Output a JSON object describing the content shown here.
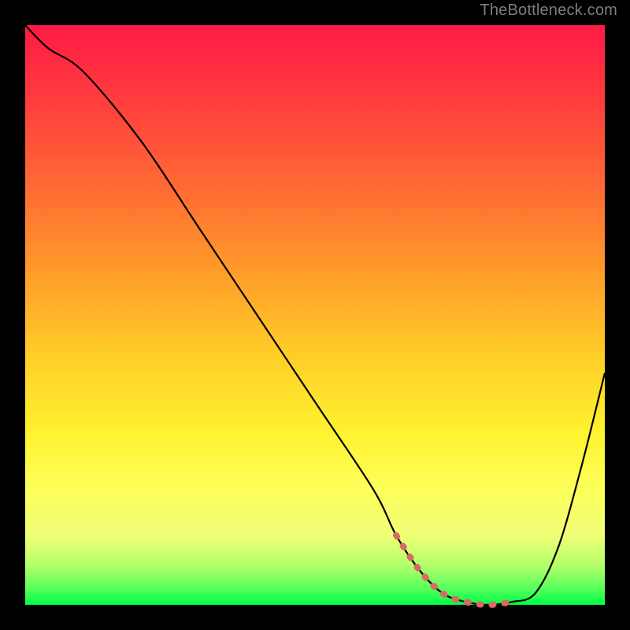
{
  "attribution": "TheBottleneck.com",
  "colors": {
    "background": "#000000",
    "curve_stroke": "#000000",
    "marker_stroke": "#d86a64",
    "attribution_text": "#7d7d7d"
  },
  "chart_data": {
    "type": "line",
    "title": "",
    "xlabel": "",
    "ylabel": "",
    "xlim": [
      0,
      100
    ],
    "ylim": [
      0,
      100
    ],
    "x": [
      0,
      4,
      10,
      20,
      30,
      40,
      50,
      60,
      64,
      68,
      72,
      76,
      80,
      84,
      88,
      92,
      96,
      100
    ],
    "values": [
      100,
      96,
      92,
      80,
      65,
      50,
      35,
      20,
      12,
      6,
      2,
      0.5,
      0,
      0.5,
      2,
      10,
      24,
      40
    ],
    "trough_marker": {
      "x": [
        64,
        68,
        72,
        76,
        80,
        84
      ],
      "values": [
        12,
        6,
        2,
        0.5,
        0,
        0.5
      ]
    },
    "notes": "x and y in percent of plot area; y=0 is bottom, y=100 is top; values estimated from pixels"
  }
}
